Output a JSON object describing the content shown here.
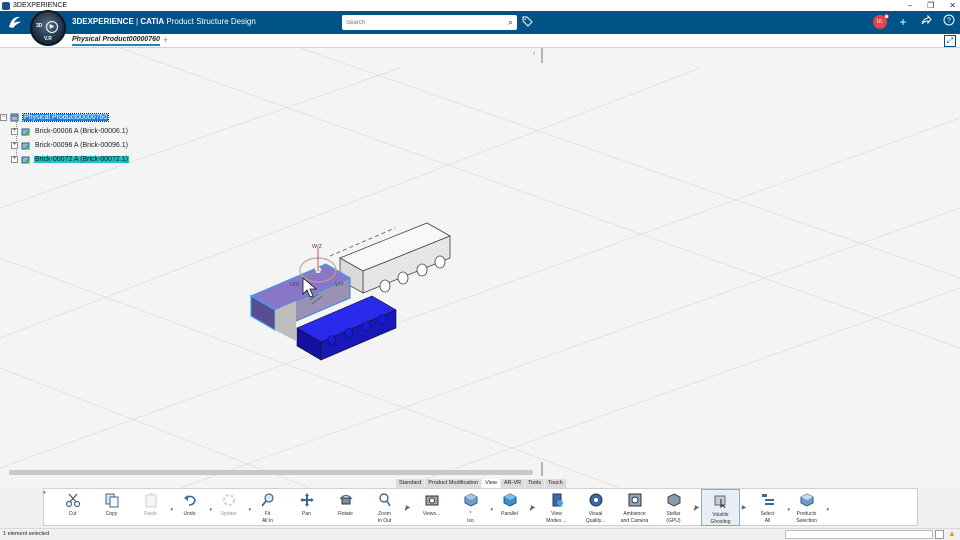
{
  "os": {
    "title": "3DEXPERIENCE",
    "minimize": "–",
    "restore": "❐",
    "close": "✕"
  },
  "brand": {
    "part1": "3DEXPERIENCE",
    "separator": " | ",
    "part2": "CATIA",
    "part3": " Product Structure Design"
  },
  "compass": {
    "label_3d": "3D",
    "version": "V.R"
  },
  "search": {
    "placeholder": "Search"
  },
  "user": {
    "initials": "UL"
  },
  "tab": {
    "active_label": "Physical Product00000760",
    "add": "+"
  },
  "tree": {
    "root": "Physical Product00000760",
    "children": [
      {
        "label": "Brick-00006 A (Brick-00006.1)"
      },
      {
        "label": "Brick-00096 A (Brick-00096.1)"
      },
      {
        "label": "Brick-00072 A (Brick-00072.1)"
      }
    ]
  },
  "robot_labels": {
    "w": "W/Z",
    "u": "U/X",
    "v": "V/Y"
  },
  "toolbar_tabs": [
    "Standard",
    "Product Modification",
    "View",
    "AR-VR",
    "Tools",
    "Touch"
  ],
  "toolbar_active_tab": "View",
  "tools": [
    {
      "label": "Cut",
      "icon": "scissors-icon"
    },
    {
      "label": "Copy",
      "icon": "copy-icon"
    },
    {
      "label": "Paste",
      "icon": "paste-icon"
    },
    {
      "label": "Undo",
      "icon": "undo-icon"
    },
    {
      "label": "Update",
      "icon": "update-icon"
    },
    {
      "label": "Fit\nAll In",
      "icon": "fit-all-icon"
    },
    {
      "label": "Pan",
      "icon": "pan-icon"
    },
    {
      "label": "Rotate",
      "icon": "rotate-icon"
    },
    {
      "label": "Zoom\nIn Out",
      "icon": "zoom-icon"
    },
    {
      "label": "Views...",
      "icon": "camera-icon"
    },
    {
      "label": "*\niso",
      "icon": "iso-icon"
    },
    {
      "label": "Parallel",
      "icon": "parallel-icon"
    },
    {
      "label": "View\nModes ...",
      "icon": "view-modes-icon"
    },
    {
      "label": "Visual\nQuality...",
      "icon": "visual-quality-icon"
    },
    {
      "label": "Ambience\nand Camera",
      "icon": "ambience-icon"
    },
    {
      "label": "Stellar\n(GPU)",
      "icon": "stellar-icon"
    },
    {
      "label": "Volatile\nGhosting",
      "icon": "ghosting-icon"
    },
    {
      "label": "Select\nAll",
      "icon": "select-all-icon"
    },
    {
      "label": "Products\nSelection",
      "icon": "products-selection-icon"
    }
  ],
  "status": {
    "text": "1 element selected"
  },
  "colors": {
    "topbar": "#005386",
    "selected_tree": "#1d7fe0",
    "selected_teal": "#22c0c9",
    "blue_brick": "#1e1ed2",
    "lilac_brick": "#6e5ca2"
  }
}
